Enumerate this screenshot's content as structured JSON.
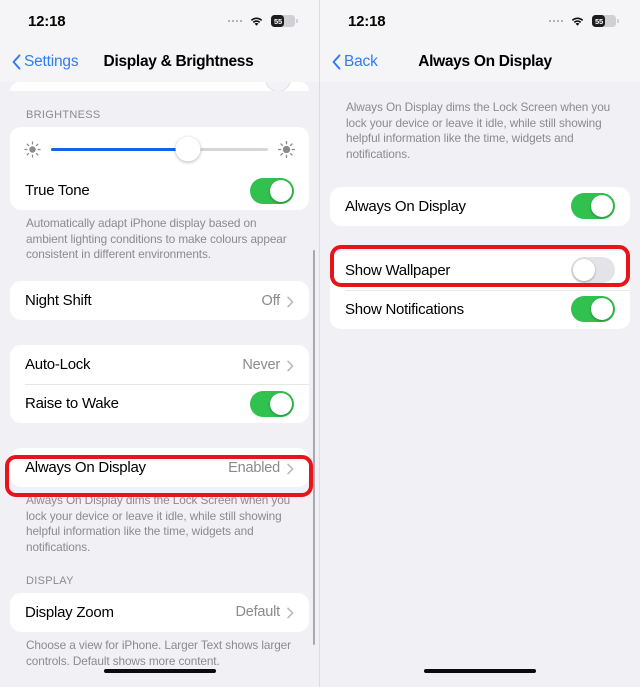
{
  "status_bar": {
    "time": "12:18",
    "battery_percent": "55",
    "wifi_icon": "wifi-icon",
    "signal_dots_icon": "signal-dots-icon",
    "battery_icon": "battery-icon"
  },
  "colors": {
    "accent_blue": "#2f7cf6",
    "slider_blue": "#1464e8",
    "toggle_green": "#30c14e",
    "highlight_red": "#e8141b",
    "background": "#f1f1f5",
    "card": "#ffffff",
    "secondary_text": "#8a8a8f"
  },
  "left_panel": {
    "nav": {
      "back_label": "Settings",
      "title": "Display & Brightness",
      "back_chevron_icon": "chevron-left-icon"
    },
    "brightness": {
      "header": "BRIGHTNESS",
      "slider_value": 63,
      "slider_min_icon": "brightness-low-icon",
      "slider_max_icon": "brightness-high-icon",
      "true_tone": {
        "label": "True Tone",
        "toggle_state": "on"
      },
      "footnote": "Automatically adapt iPhone display based on ambient lighting conditions to make colours appear consistent in different environments."
    },
    "night_shift": {
      "label": "Night Shift",
      "value": "Off",
      "chevron_icon": "chevron-right-icon"
    },
    "lock_group": [
      {
        "label": "Auto-Lock",
        "value": "Never",
        "type": "disclosure",
        "chevron_icon": "chevron-right-icon"
      },
      {
        "label": "Raise to Wake",
        "type": "toggle",
        "toggle_state": "on"
      }
    ],
    "always_on_display": {
      "label": "Always On Display",
      "value": "Enabled",
      "chevron_icon": "chevron-right-icon",
      "highlighted": true,
      "footnote": "Always On Display dims the Lock Screen when you lock your device or leave it idle, while still showing helpful information like the time, widgets and notifications."
    },
    "display": {
      "header": "DISPLAY",
      "zoom": {
        "label": "Display Zoom",
        "value": "Default",
        "chevron_icon": "chevron-right-icon"
      },
      "footnote": "Choose a view for iPhone. Larger Text shows larger controls. Default shows more content."
    }
  },
  "right_panel": {
    "nav": {
      "back_label": "Back",
      "title": "Always On Display",
      "back_chevron_icon": "chevron-left-icon"
    },
    "description": "Always On Display dims the Lock Screen when you lock your device or leave it idle, while still showing helpful information like the time, widgets and notifications.",
    "rows": [
      {
        "label": "Always On Display",
        "toggle_state": "on",
        "highlighted": false
      },
      {
        "label": "Show Wallpaper",
        "toggle_state": "off",
        "highlighted": true
      },
      {
        "label": "Show Notifications",
        "toggle_state": "on",
        "highlighted": false
      }
    ]
  }
}
